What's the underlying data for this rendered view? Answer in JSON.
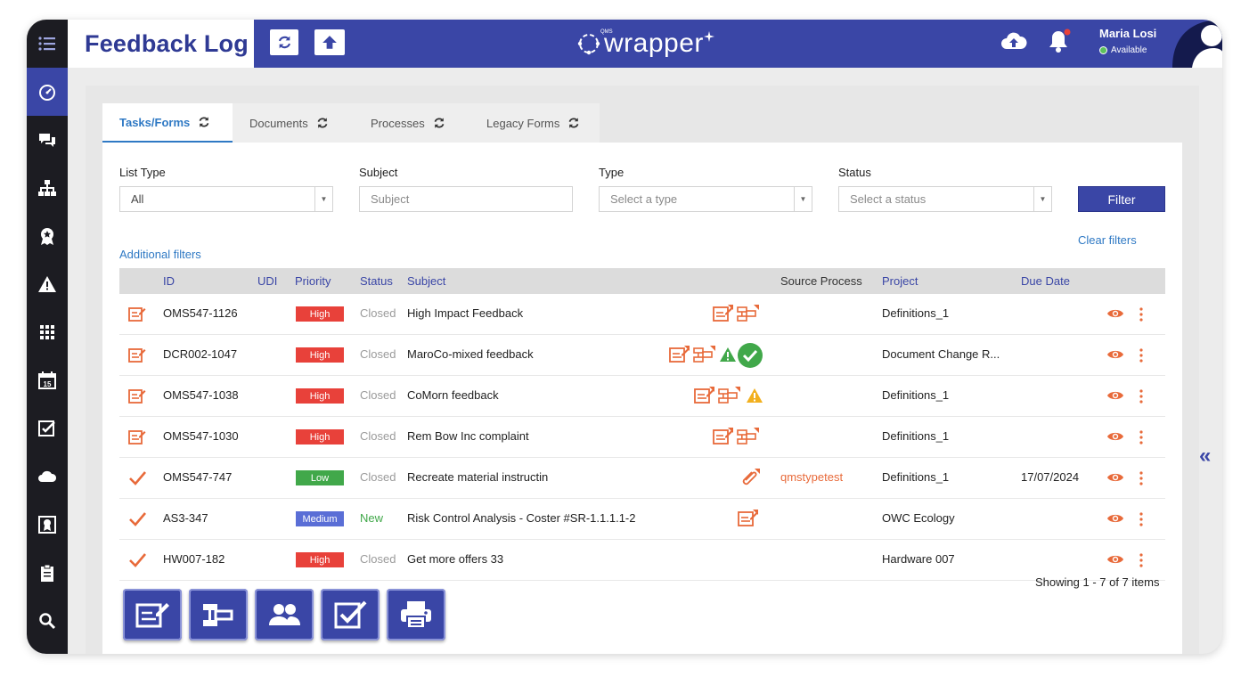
{
  "app": {
    "title": "Feedback Log",
    "logo_text": "wrapper",
    "logo_small": "QMS"
  },
  "user": {
    "name": "Maria Losi",
    "status": "Available"
  },
  "sidebar": {
    "items": [
      {
        "icon": "menu-icon"
      },
      {
        "icon": "dashboard-icon"
      },
      {
        "icon": "chat-icon"
      },
      {
        "icon": "org-chart-icon"
      },
      {
        "icon": "badge-icon"
      },
      {
        "icon": "warning-icon"
      },
      {
        "icon": "apps-grid-icon"
      },
      {
        "icon": "calendar-icon"
      },
      {
        "icon": "checklist-icon"
      },
      {
        "icon": "cloud-icon"
      },
      {
        "icon": "certificate-icon"
      },
      {
        "icon": "clipboard-icon"
      },
      {
        "icon": "search-icon"
      }
    ],
    "calendar_day": "15"
  },
  "tabs": [
    {
      "label": "Tasks/Forms",
      "active": true
    },
    {
      "label": "Documents",
      "active": false
    },
    {
      "label": "Processes",
      "active": false
    },
    {
      "label": "Legacy Forms",
      "active": false
    }
  ],
  "filters": {
    "list_type": {
      "label": "List Type",
      "value": "All"
    },
    "subject": {
      "label": "Subject",
      "placeholder": "Subject"
    },
    "type": {
      "label": "Type",
      "placeholder": "Select a type"
    },
    "status": {
      "label": "Status",
      "placeholder": "Select a status"
    },
    "filter_button": "Filter",
    "clear_filters": "Clear filters",
    "additional_filters": "Additional filters"
  },
  "table": {
    "columns": {
      "id": "ID",
      "udi": "UDI",
      "priority": "Priority",
      "status": "Status",
      "subject": "Subject",
      "source_process": "Source Process",
      "project": "Project",
      "due_date": "Due Date"
    },
    "rows": [
      {
        "type_icon": "form-icon",
        "id": "OMS547-1126",
        "priority": "High",
        "status": "Closed",
        "subject": "High Impact Feedback",
        "source_process": "",
        "project": "Definitions_1",
        "due_date": ""
      },
      {
        "type_icon": "form-icon",
        "id": "DCR002-1047",
        "priority": "High",
        "status": "Closed",
        "subject": "MaroCo-mixed feedback",
        "source_process": "",
        "project": "Document Change R...",
        "due_date": ""
      },
      {
        "type_icon": "form-icon",
        "id": "OMS547-1038",
        "priority": "High",
        "status": "Closed",
        "subject": "CoMorn feedback",
        "source_process": "",
        "project": "Definitions_1",
        "due_date": ""
      },
      {
        "type_icon": "form-icon",
        "id": "OMS547-1030",
        "priority": "High",
        "status": "Closed",
        "subject": "Rem Bow Inc complaint",
        "source_process": "",
        "project": "Definitions_1",
        "due_date": ""
      },
      {
        "type_icon": "check-icon",
        "id": "OMS547-747",
        "priority": "Low",
        "status": "Closed",
        "subject": "Recreate material instructin",
        "source_process": "qmstypetest",
        "project": "Definitions_1",
        "due_date": "17/07/2024"
      },
      {
        "type_icon": "check-icon",
        "id": "AS3-347",
        "priority": "Medium",
        "status": "New",
        "subject": "Risk Control Analysis - Coster #SR-1.1.1.1-2",
        "source_process": "",
        "project": "OWC Ecology",
        "due_date": ""
      },
      {
        "type_icon": "check-icon",
        "id": "HW007-182",
        "priority": "High",
        "status": "Closed",
        "subject": "Get more offers 33",
        "source_process": "",
        "project": "Hardware 007",
        "due_date": ""
      }
    ],
    "summary": "Showing 1 - 7 of 7 items"
  },
  "bottom_actions": [
    {
      "icon": "new-form-icon"
    },
    {
      "icon": "process-icon"
    },
    {
      "icon": "users-icon"
    },
    {
      "icon": "task-check-icon"
    },
    {
      "icon": "print-icon"
    }
  ],
  "colors": {
    "brand": "#3a46a6",
    "accent": "#e86a3a",
    "high": "#e8413a",
    "low": "#41a84a",
    "medium": "#5a6ed6"
  }
}
